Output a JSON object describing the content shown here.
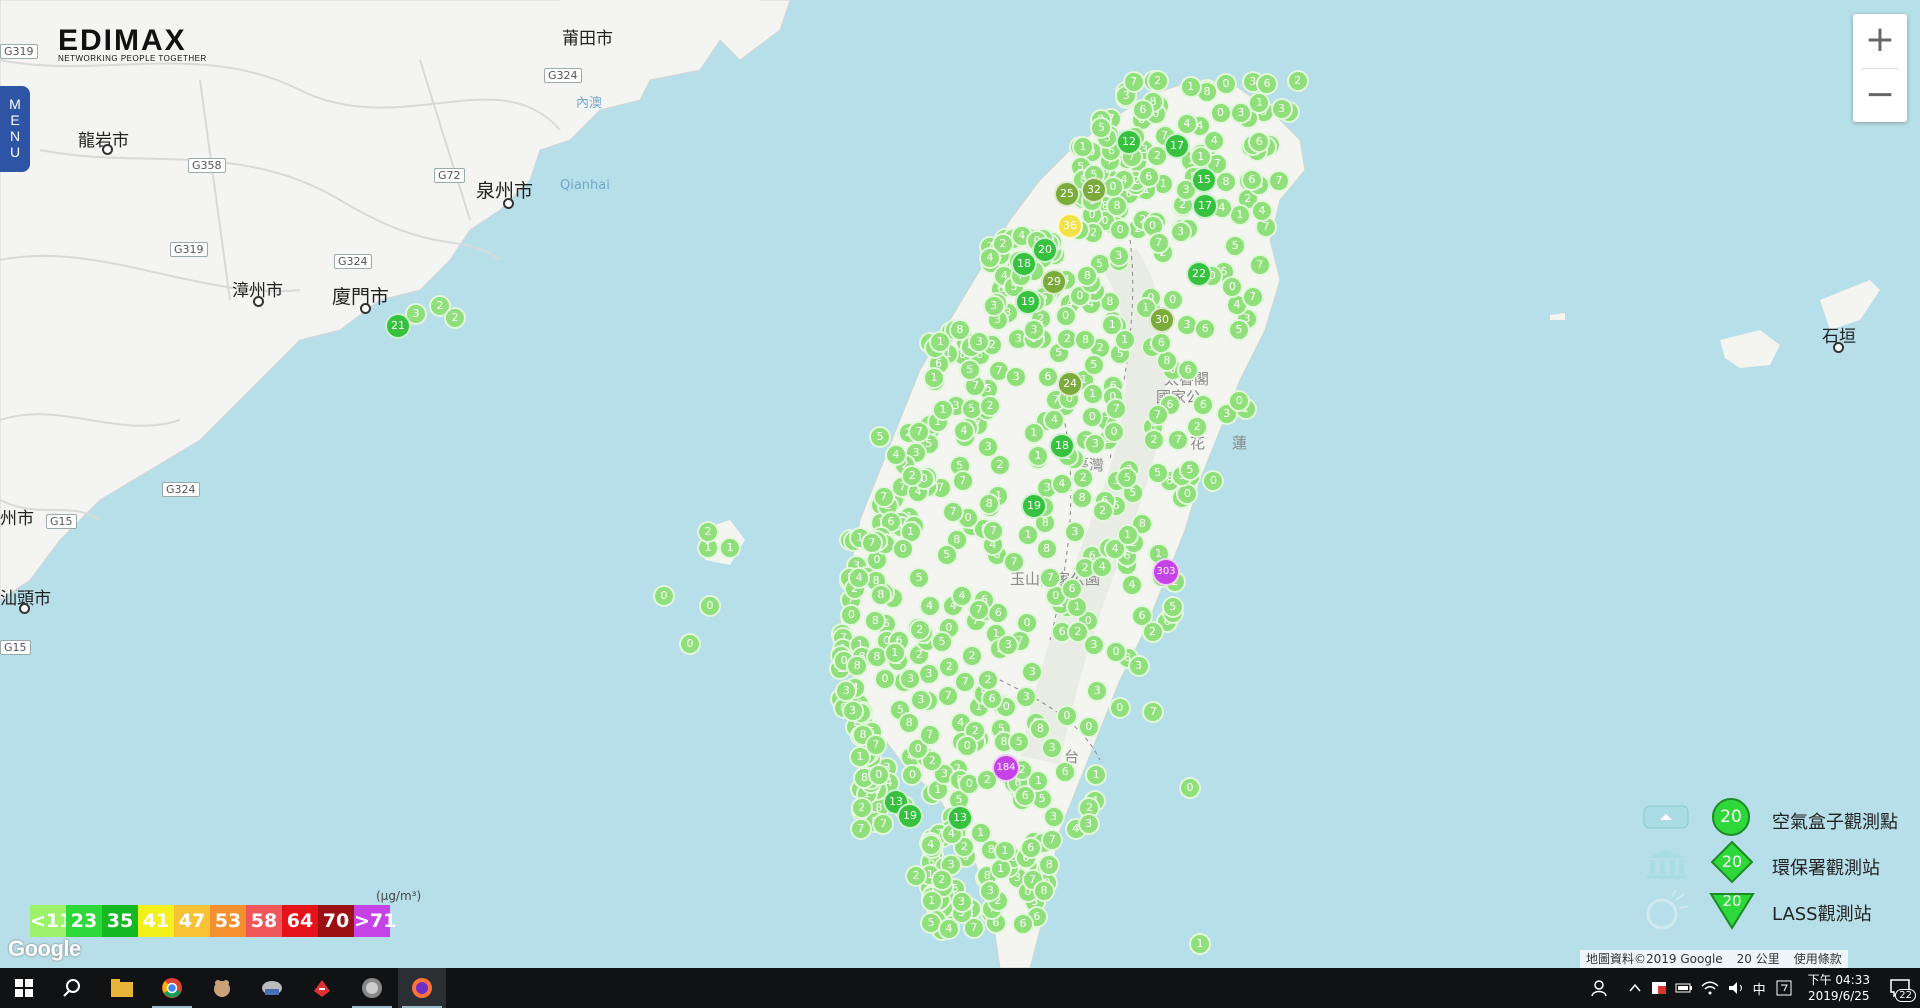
{
  "app": {
    "logo_brand": "EDIMAX",
    "logo_tagline": "NETWORKING PEOPLE TOGETHER",
    "menu_label": "MENU"
  },
  "zoom": {
    "in_label": "+",
    "out_label": "−"
  },
  "map_labels": {
    "cities": [
      "莆田市",
      "龍岩市",
      "泉州市",
      "漳州市",
      "廈門市",
      "州市",
      "汕頭市",
      "石垣"
    ],
    "water": [
      "內澳",
      "Qianhai"
    ],
    "parks": [
      "太魯閣",
      "國家公",
      "臺灣",
      "玉山國家公園",
      "花",
      "蓮",
      "台"
    ],
    "roads": [
      "G319",
      "G324",
      "G358",
      "G72",
      "G319",
      "G324",
      "G324",
      "G15",
      "G15"
    ]
  },
  "scale": {
    "unit": "(μg/m³)",
    "cells": [
      {
        "label": "<11",
        "color": "#9cf26b"
      },
      {
        "label": "23",
        "color": "#2fd83a"
      },
      {
        "label": "35",
        "color": "#15b922"
      },
      {
        "label": "41",
        "color": "#f2f11b"
      },
      {
        "label": "47",
        "color": "#f7c234"
      },
      {
        "label": "53",
        "color": "#f4902e"
      },
      {
        "label": "58",
        "color": "#f0575a"
      },
      {
        "label": "64",
        "color": "#e6121a"
      },
      {
        "label": "70",
        "color": "#9c0f12"
      },
      {
        "label": ">71",
        "color": "#c543e6"
      }
    ]
  },
  "google_logo": "Google",
  "legend": [
    {
      "icon": "airbox-icon",
      "badge": "20",
      "label": "空氣盒子觀測點"
    },
    {
      "icon": "epa-building-icon",
      "badge": "20",
      "label": "環保署觀測站"
    },
    {
      "icon": "lass-icon",
      "badge": "20",
      "label": "LASS觀測站"
    }
  ],
  "attribution": {
    "map_data": "地圖資料©2019 Google",
    "scale": "20 公里",
    "terms": "使用條款"
  },
  "markers": [
    {
      "v": "3"
    },
    {
      "v": "2"
    },
    {
      "v": "2"
    },
    {
      "v": "21"
    },
    {
      "v": "1"
    },
    {
      "v": "1"
    },
    {
      "v": "2"
    },
    {
      "v": "0"
    },
    {
      "v": "0"
    },
    {
      "v": "0"
    },
    {
      "v": "12"
    },
    {
      "v": "17"
    },
    {
      "v": "25"
    },
    {
      "v": "32"
    },
    {
      "v": "36"
    },
    {
      "v": "20"
    },
    {
      "v": "18"
    },
    {
      "v": "19"
    },
    {
      "v": "29"
    },
    {
      "v": "15"
    },
    {
      "v": "17"
    },
    {
      "v": "22"
    },
    {
      "v": "30"
    },
    {
      "v": "24"
    },
    {
      "v": "18"
    },
    {
      "v": "19"
    },
    {
      "v": "303"
    },
    {
      "v": "184"
    },
    {
      "v": "13"
    },
    {
      "v": "19"
    },
    {
      "v": "13"
    },
    {
      "v": "2"
    },
    {
      "v": "0"
    },
    {
      "v": "1"
    },
    {
      "v": "3"
    },
    {
      "v": "5"
    },
    {
      "v": "8"
    },
    {
      "v": "7"
    }
  ],
  "taskbar": {
    "apps": [
      "windows-start-icon",
      "search-icon",
      "file-explorer-icon",
      "chrome-icon",
      "app-icon",
      "app-icon",
      "app-icon",
      "app-icon",
      "firefox-icon"
    ],
    "ime": "中",
    "time": "下午 04:33",
    "date": "2019/6/25",
    "notifications": "22"
  }
}
